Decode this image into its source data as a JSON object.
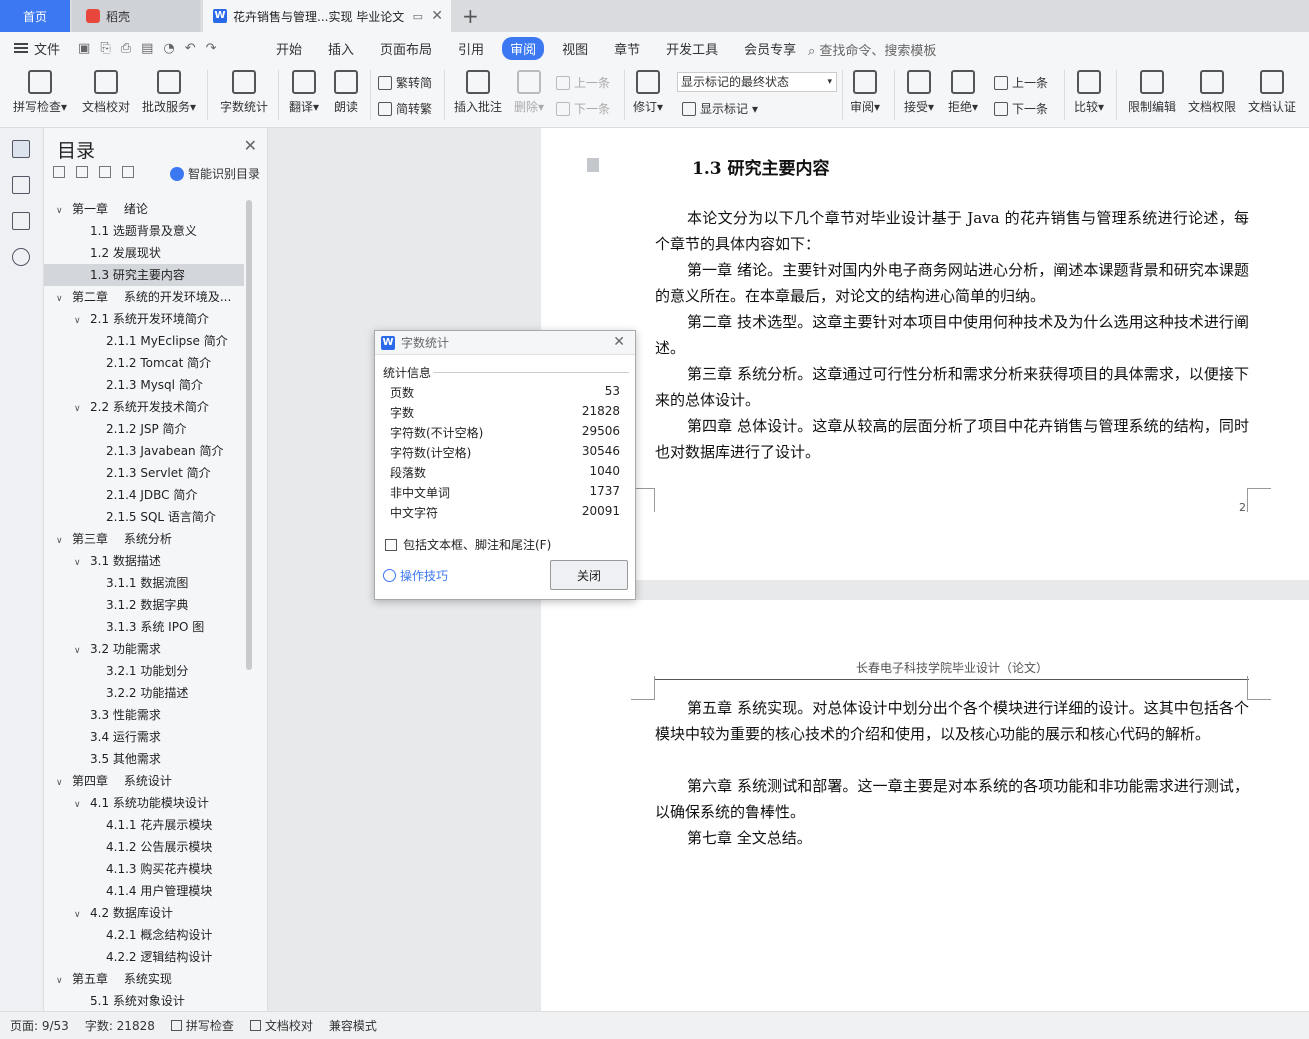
{
  "tabs": {
    "home": "首页",
    "daoke": "稻壳",
    "doc": "花卉销售与管理...实现 毕业论文"
  },
  "menu": {
    "file": "文件",
    "items": [
      "开始",
      "插入",
      "页面布局",
      "引用",
      "审阅",
      "视图",
      "章节",
      "开发工具",
      "会员专享"
    ],
    "active": "审阅",
    "search": "查找命令、搜索模板"
  },
  "ribbon": {
    "spell": "拼写检查",
    "proof": "文档校对",
    "review_service": "批改服务",
    "word_count": "字数统计",
    "translate": "翻译",
    "read_aloud": "朗读",
    "trad": "繁转简",
    "simp": "简转繁",
    "insert_comment": "插入批注",
    "delete": "删除",
    "prev1": "上一条",
    "next1": "下一条",
    "revise": "修订",
    "mark_state": "显示标记的最终状态",
    "show_marks": "显示标记",
    "review": "审阅",
    "accept": "接受",
    "reject": "拒绝",
    "prev2": "上一条",
    "next2": "下一条",
    "compare": "比较",
    "restrict": "限制编辑",
    "permission": "文档权限",
    "cert": "文档认证"
  },
  "toc": {
    "title": "目录",
    "smart": "智能识别目录",
    "items": [
      {
        "level": 1,
        "caret": "∨",
        "text": "第一章　 绪论"
      },
      {
        "level": 2,
        "caret": "",
        "text": "1.1 选题背景及意义"
      },
      {
        "level": 2,
        "caret": "",
        "text": "1.2 发展现状"
      },
      {
        "level": 2,
        "caret": "",
        "text": "1.3 研究主要内容",
        "selected": true
      },
      {
        "level": 1,
        "caret": "∨",
        "text": "第二章　 系统的开发环境及..."
      },
      {
        "level": 2,
        "caret": "∨",
        "text": "2.1 系统开发环境简介"
      },
      {
        "level": 3,
        "caret": "",
        "text": "2.1.1 MyEclipse 简介"
      },
      {
        "level": 3,
        "caret": "",
        "text": "2.1.2 Tomcat 简介"
      },
      {
        "level": 3,
        "caret": "",
        "text": "2.1.3 Mysql 简介"
      },
      {
        "level": 2,
        "caret": "∨",
        "text": "2.2 系统开发技术简介"
      },
      {
        "level": 3,
        "caret": "",
        "text": "2.1.2 JSP 简介"
      },
      {
        "level": 3,
        "caret": "",
        "text": "2.1.3 Javabean 简介"
      },
      {
        "level": 3,
        "caret": "",
        "text": "2.1.3 Servlet 简介"
      },
      {
        "level": 3,
        "caret": "",
        "text": "2.1.4 JDBC 简介"
      },
      {
        "level": 3,
        "caret": "",
        "text": "2.1.5 SQL 语言简介"
      },
      {
        "level": 1,
        "caret": "∨",
        "text": "第三章　 系统分析"
      },
      {
        "level": 2,
        "caret": "∨",
        "text": "3.1 数据描述"
      },
      {
        "level": 3,
        "caret": "",
        "text": "3.1.1 数据流图"
      },
      {
        "level": 3,
        "caret": "",
        "text": "3.1.2 数据字典"
      },
      {
        "level": 3,
        "caret": "",
        "text": "3.1.3 系统 IPO 图"
      },
      {
        "level": 2,
        "caret": "∨",
        "text": "3.2 功能需求"
      },
      {
        "level": 3,
        "caret": "",
        "text": "3.2.1 功能划分"
      },
      {
        "level": 3,
        "caret": "",
        "text": "3.2.2 功能描述"
      },
      {
        "level": 2,
        "caret": "",
        "text": "3.3 性能需求"
      },
      {
        "level": 2,
        "caret": "",
        "text": "3.4 运行需求"
      },
      {
        "level": 2,
        "caret": "",
        "text": "3.5 其他需求"
      },
      {
        "level": 1,
        "caret": "∨",
        "text": "第四章　 系统设计"
      },
      {
        "level": 2,
        "caret": "∨",
        "text": "4.1 系统功能模块设计"
      },
      {
        "level": 3,
        "caret": "",
        "text": "4.1.1 花卉展示模块"
      },
      {
        "level": 3,
        "caret": "",
        "text": "4.1.2 公告展示模块"
      },
      {
        "level": 3,
        "caret": "",
        "text": "4.1.3 购买花卉模块"
      },
      {
        "level": 3,
        "caret": "",
        "text": "4.1.4 用户管理模块"
      },
      {
        "level": 2,
        "caret": "∨",
        "text": "4.2 数据库设计"
      },
      {
        "level": 3,
        "caret": "",
        "text": "4.2.1 概念结构设计"
      },
      {
        "level": 3,
        "caret": "",
        "text": "4.2.2 逻辑结构设计"
      },
      {
        "level": 1,
        "caret": "∨",
        "text": "第五章　 系统实现"
      },
      {
        "level": 2,
        "caret": "",
        "text": "5.1 系统对象设计"
      }
    ]
  },
  "document": {
    "heading": "1.3 研究主要内容",
    "page1_paragraphs": [
      "本论文分为以下几个章节对毕业设计基于 Java 的花卉销售与管理系统进行论述，每个章节的具体内容如下：",
      "第一章 绪论。主要针对国内外电子商务网站进心分析，阐述本课题背景和研究本课题的意义所在。在本章最后，对论文的结构进心简单的归纳。",
      "第二章 技术选型。这章主要针对本项目中使用何种技术及为什么选用这种技术进行阐述。",
      "第三章 系统分析。这章通过可行性分析和需求分析来获得项目的具体需求，以便接下来的总体设计。",
      "第四章 总体设计。这章从较高的层面分析了项目中花卉销售与管理系统的结构，同时也对数据库进行了设计。"
    ],
    "page_number": "2",
    "page2_header": "长春电子科技学院毕业设计（论文）",
    "page2_paragraphs": [
      "第五章 系统实现。对总体设计中划分出个各个模块进行详细的设计。这其中包括各个模块中较为重要的核心技术的介绍和使用，以及核心功能的展示和核心代码的解析。",
      "第六章 系统测试和部署。这一章主要是对本系统的各项功能和非功能需求进行测试，以确保系统的鲁棒性。",
      "第七章 全文总结。"
    ]
  },
  "dialog": {
    "title": "字数统计",
    "section": "统计信息",
    "stats": [
      {
        "label": "页数",
        "value": "53"
      },
      {
        "label": "字数",
        "value": "21828"
      },
      {
        "label": "字符数(不计空格)",
        "value": "29506"
      },
      {
        "label": "字符数(计空格)",
        "value": "30546"
      },
      {
        "label": "段落数",
        "value": "1040"
      },
      {
        "label": "非中文单词",
        "value": "1737"
      },
      {
        "label": "中文字符",
        "value": "20091"
      }
    ],
    "checkbox": "包括文本框、脚注和尾注(F)",
    "tips": "操作技巧",
    "close": "关闭"
  },
  "status": {
    "page": "页面: 9/53",
    "words": "字数: 21828",
    "spell": "拼写检查",
    "proof": "文档校对",
    "compat": "兼容模式"
  }
}
